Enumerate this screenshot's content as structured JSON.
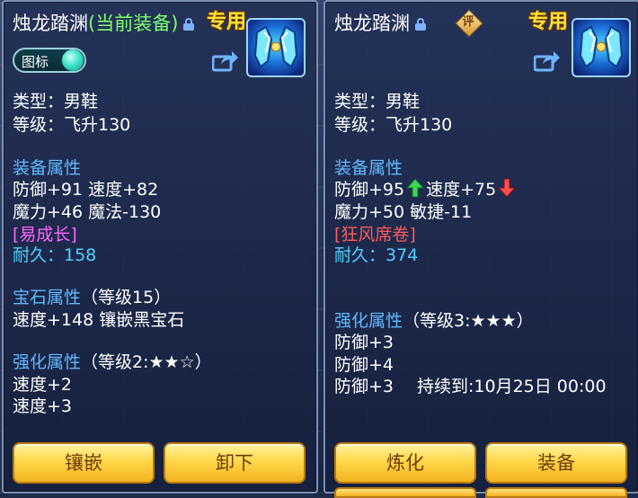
{
  "left": {
    "item_name": "烛龙踏渊",
    "current_tag": "(当前装备)",
    "exclusive_label": "专用",
    "toggle_label": "图标",
    "type_line": "类型：男鞋",
    "level_line": "等级：飞升130",
    "equip_attr_title": "装备属性",
    "attr_line1": "防御+91 速度+82",
    "attr_line2": "魔力+46 魔法-130",
    "special": "[易成长]",
    "durability": "耐久：158",
    "gem_title": "宝石属性",
    "gem_level": "（等级15）",
    "gem_line": "速度+148 镶嵌黑宝石",
    "enhance_title": "强化属性",
    "enhance_level": "（等级2:★★☆）",
    "enhance_line1": "速度+2",
    "enhance_line2": "速度+3",
    "button1": "镶嵌",
    "button2": "卸下"
  },
  "right": {
    "item_name": "烛龙踏渊",
    "rate_badge": "评",
    "exclusive_label": "专用",
    "type_line": "类型：男鞋",
    "level_line": "等级：飞升130",
    "equip_attr_title": "装备属性",
    "attr_def": "防御+95",
    "attr_spd": "速度+75",
    "attr_line2": "魔力+50 敏捷-11",
    "special": "[狂风席卷]",
    "durability": "耐久：374",
    "enhance_title": "强化属性",
    "enhance_level": "（等级3:★★★）",
    "enhance_line1": "防御+3",
    "enhance_line2": "防御+4",
    "enhance_line3": "防御+3",
    "expire": "持续到:10月25日 00:00",
    "button1": "炼化",
    "button2": "装备"
  },
  "colors": {
    "title": "#ffffff",
    "current_equip": "#7dff6c",
    "section": "#5fb9ff",
    "special_left": "#ff63ff",
    "special_right": "#ff5b5b",
    "durability": "#4fd0ff",
    "button_text": "#6e3b07",
    "exclusive": "#ffe23a"
  },
  "icons": {
    "lock": "lock-icon",
    "share": "share-icon",
    "up": "green-up-arrow-icon",
    "down": "red-down-arrow-icon"
  }
}
